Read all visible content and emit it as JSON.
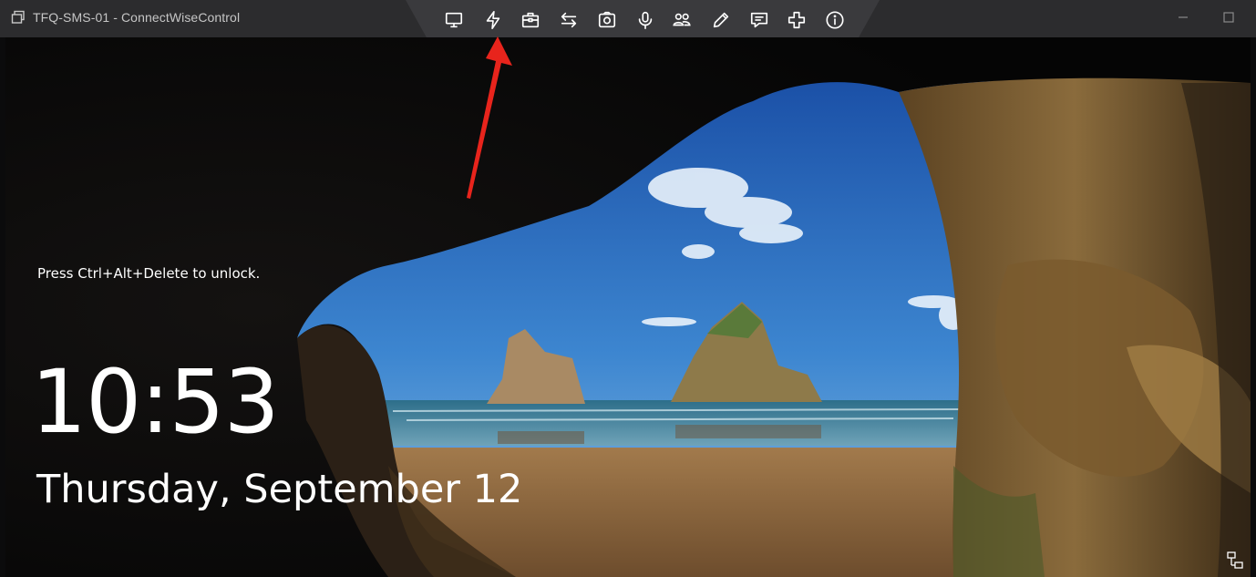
{
  "window": {
    "title": "TFQ-SMS-01 - ConnectWiseControl",
    "controls": [
      "minimize-icon",
      "maximize-icon"
    ]
  },
  "toolbar": {
    "tools": [
      {
        "name": "screen-icon"
      },
      {
        "name": "lightning-icon"
      },
      {
        "name": "toolbox-icon"
      },
      {
        "name": "transfer-icon"
      },
      {
        "name": "camera-icon"
      },
      {
        "name": "microphone-icon"
      },
      {
        "name": "users-icon"
      },
      {
        "name": "pencil-icon"
      },
      {
        "name": "chat-icon"
      },
      {
        "name": "plus-icon"
      },
      {
        "name": "info-icon"
      }
    ]
  },
  "lockscreen": {
    "prompt": "Press Ctrl+Alt+Delete to unlock.",
    "time": "10:53",
    "date": "Thursday, September 12"
  },
  "colors": {
    "titlebar": "#2c2c2e",
    "toolbar": "#3a3a3d",
    "annotation_arrow": "#e8241c"
  }
}
